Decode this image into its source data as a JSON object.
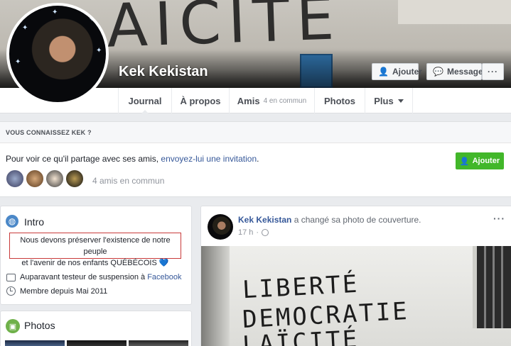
{
  "profile": {
    "name": "Kek Kekistan",
    "cover_graffiti": "AÏCITÉ",
    "buttons": {
      "add_friend": "Ajouter",
      "message": "Message",
      "more": "···"
    }
  },
  "tabs": [
    {
      "label": "Journal"
    },
    {
      "label": "À propos"
    },
    {
      "label": "Amis",
      "sub": "4 en commun"
    },
    {
      "label": "Photos"
    },
    {
      "label": "Plus"
    }
  ],
  "know": {
    "heading": "VOUS CONNAISSEZ KEK ?",
    "text_before": "Pour voir ce qu'il partage avec ses amis, ",
    "invite_link": "envoyez-lui une invitation",
    "text_after": ".",
    "add_button": "Ajouter",
    "mutual_friends": "4 amis en commun"
  },
  "intro": {
    "title": "Intro",
    "bio_line1": "Nous devons préserver l'existence de notre peuple",
    "bio_line2": "et l'avenir de nos enfants QUÉBÉCOIS",
    "work_prefix": "Auparavant testeur de suspension à ",
    "work_link": "Facebook",
    "member_since": "Membre depuis Mai 2011"
  },
  "photos": {
    "title": "Photos"
  },
  "post": {
    "author": "Kek Kekistan",
    "action": " a changé sa photo de couverture.",
    "time": "17 h",
    "separator": "·",
    "more": "···",
    "graffiti": [
      "LIBERTÉ",
      "DEMOCRATIE",
      "LAÏCITÉ"
    ]
  },
  "colors": {
    "link": "#365899",
    "green": "#42b72a",
    "bio_border": "#c93a3a"
  }
}
